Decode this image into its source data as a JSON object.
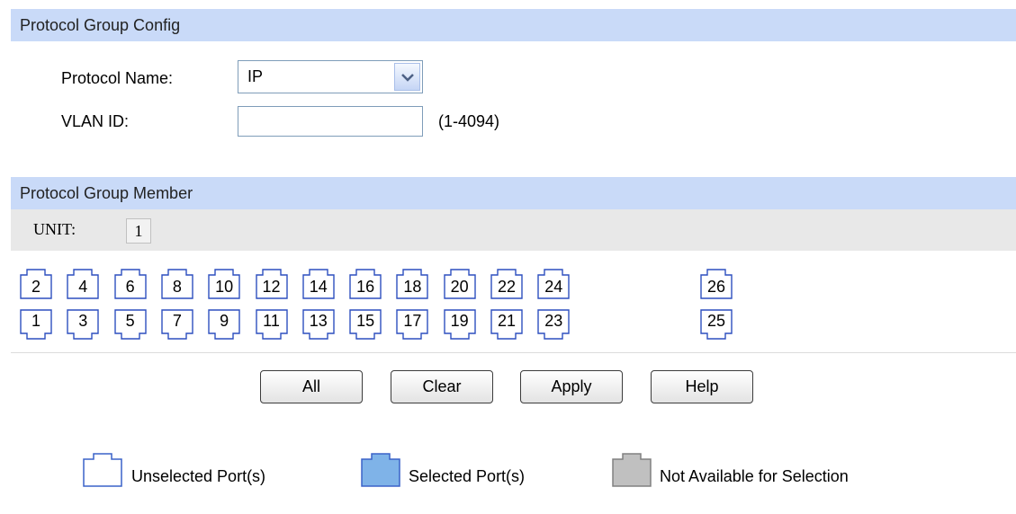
{
  "config": {
    "header": "Protocol Group Config",
    "protocol_name_label": "Protocol Name:",
    "protocol_name_value": "IP",
    "vlan_id_label": "VLAN ID:",
    "vlan_id_value": "",
    "vlan_id_hint": "(1-4094)"
  },
  "member": {
    "header": "Protocol Group Member",
    "unit_label": "UNIT:",
    "unit_value": "1",
    "ports_top": [
      "2",
      "4",
      "6",
      "8",
      "10",
      "12",
      "14",
      "16",
      "18",
      "20",
      "22",
      "24",
      "26"
    ],
    "ports_bottom": [
      "1",
      "3",
      "5",
      "7",
      "9",
      "11",
      "13",
      "15",
      "17",
      "19",
      "21",
      "23",
      "25"
    ]
  },
  "buttons": {
    "all": "All",
    "clear": "Clear",
    "apply": "Apply",
    "help": "Help"
  },
  "legend": {
    "unselected": "Unselected Port(s)",
    "selected": "Selected Port(s)",
    "not_available": "Not Available for Selection"
  },
  "colors": {
    "header_bg": "#c9daf8",
    "port_border": "#2d4fbf",
    "selected_fill": "#7fb3e8",
    "not_available_fill": "#c0c0c0"
  }
}
